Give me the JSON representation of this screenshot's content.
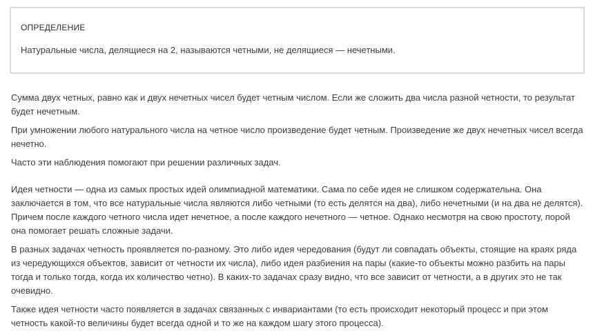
{
  "definition": {
    "title": "ОПРЕДЕЛЕНИЕ",
    "text": "Натуральные числа, делящиеся на 2, называются четными, не делящиеся — нечетными."
  },
  "paragraphs": [
    "Сумма двух четных, равно как и двух нечетных чисел будет четным числом. Если же сложить два числа разной четности, то результат будет нечетным.",
    "При умножении любого натурального числа на четное число произведение будет четным. Произведение же двух нечетных чисел всегда нечетно.",
    "Часто эти наблюдения помогают при решении различных задач.",
    "Идея четности — одна из самых простых идей олимпиадной математики. Сама по себе идея не слишком содержательна. Она заключается в том, что все натуральные числа являются либо четными (то есть делятся на два), либо нечетными (и на два не делятся). Причем после каждого четного числа идет нечетное, а после каждого нечетного — четное. Однако несмотря на свою простоту, порой она помогает решать сложные задачи.",
    "В разных задачах четность проявляется по-разному. Это либо идея чередования (будут ли совпадать объекты, стоящие на краях ряда из чередующихся объектов, зависит от четности их числа), либо идея разбиения на пары (какие-то объекты можно разбить на пары тогда и только тогда, когда их количество четно). В каких-то задачах сразу видно, что все зависит от четности, а в других это не так очевидно.",
    "Также идея четности часто появляется в задачах связанных с инвариантами (то есть происходит некоторый процесс и при этом четность какой-то величины будет всегда одной и то же на каждом шагу этого процесса)."
  ]
}
